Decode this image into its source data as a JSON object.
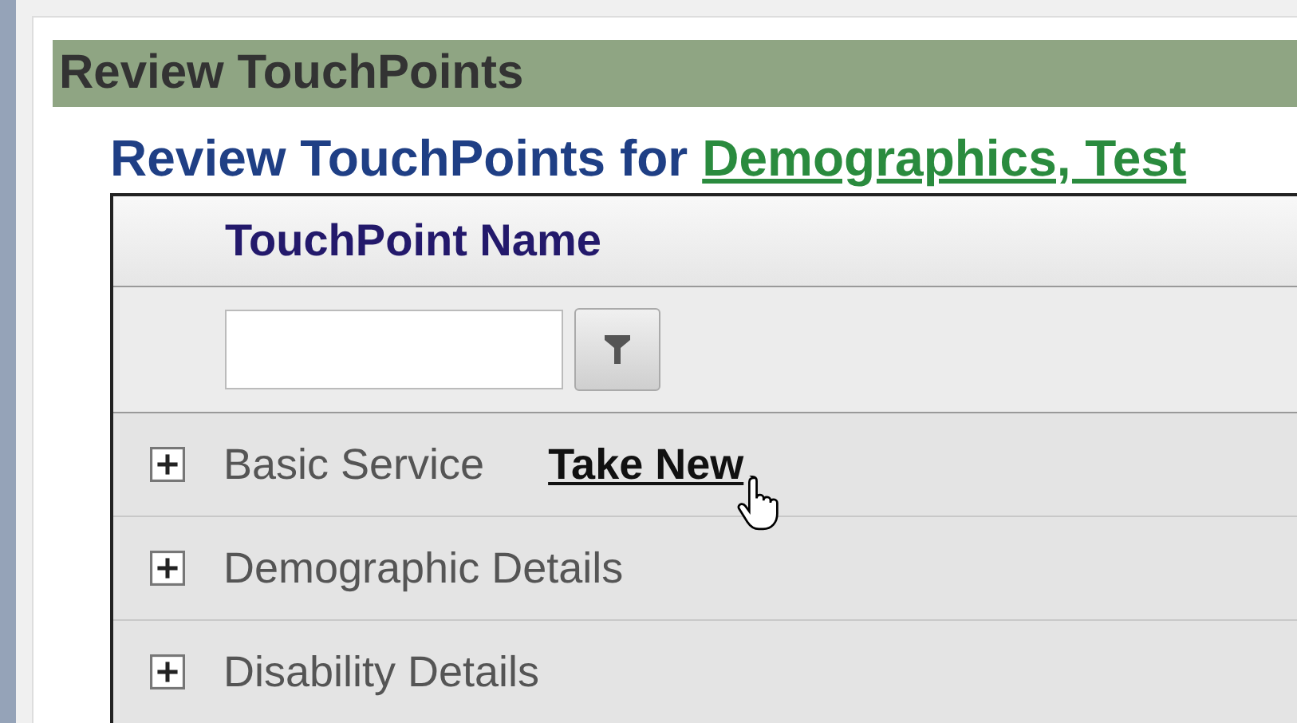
{
  "panel": {
    "title": "Review TouchPoints"
  },
  "subtitle": {
    "text": "Review TouchPoints for",
    "client_link": "Demographics, Test"
  },
  "table": {
    "columns": [
      "TouchPoint Name"
    ],
    "rows": [
      {
        "name": "Basic Service",
        "expanded": false,
        "action": "Take New",
        "hovered": true
      },
      {
        "name": "Demographic Details",
        "expanded": false
      },
      {
        "name": "Disability Details",
        "expanded": false
      }
    ]
  }
}
